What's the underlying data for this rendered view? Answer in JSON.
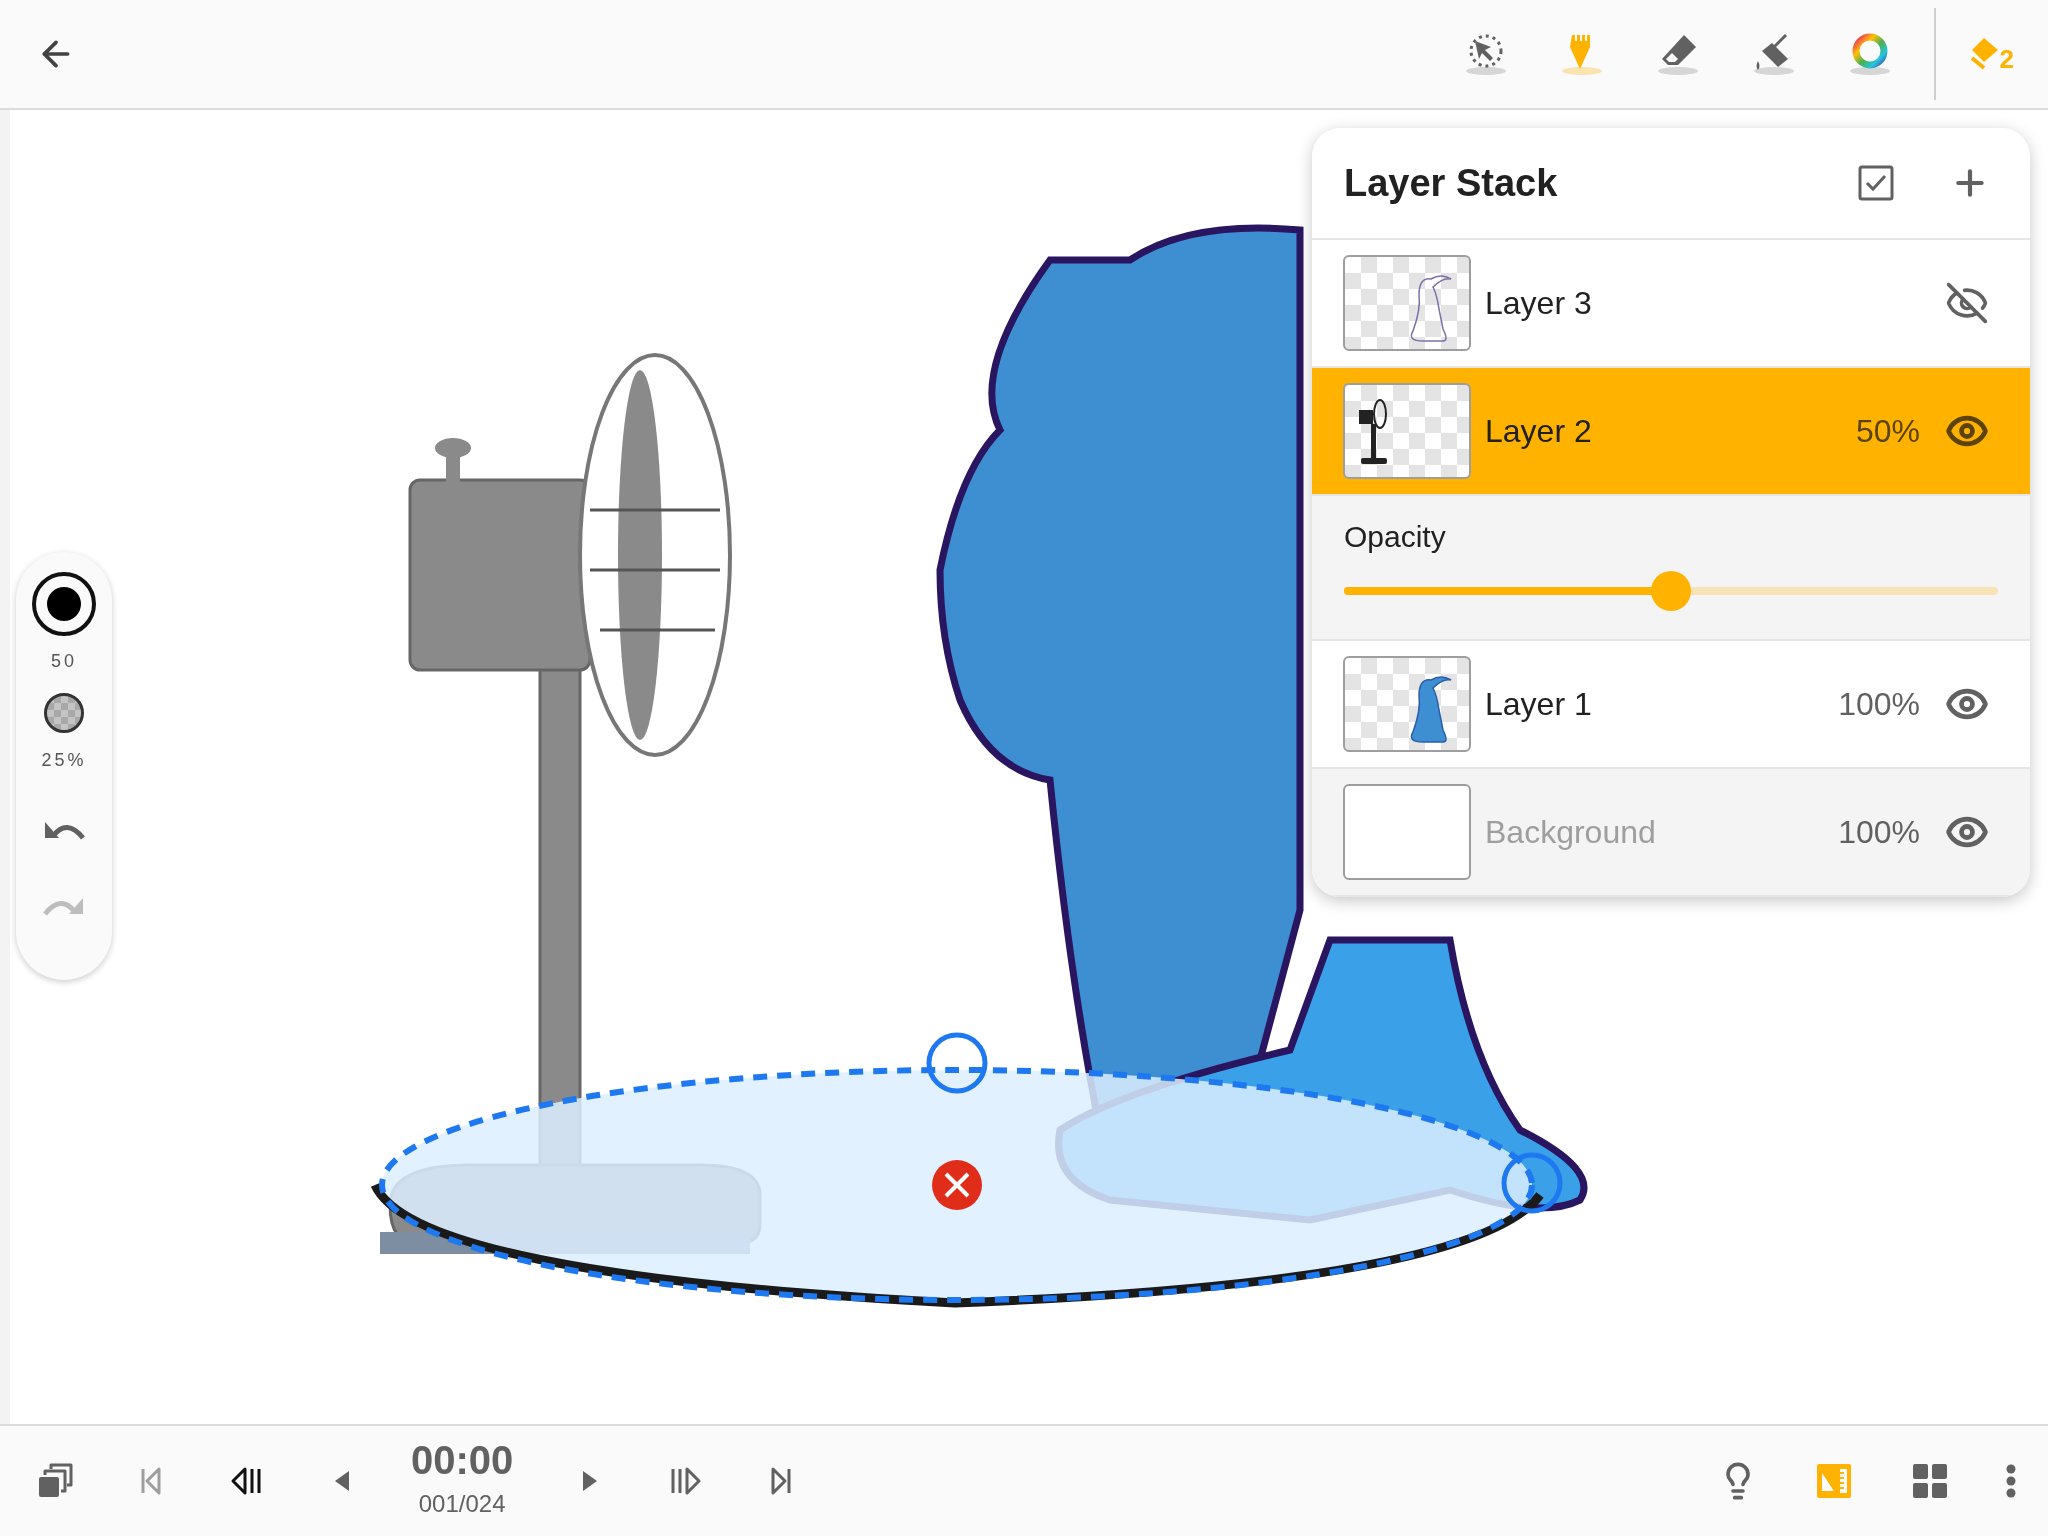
{
  "toolbar": {
    "tools": [
      {
        "kind": "select",
        "selected": false
      },
      {
        "kind": "pencil",
        "selected": true
      },
      {
        "kind": "eraser",
        "selected": false
      },
      {
        "kind": "fill",
        "selected": false
      },
      {
        "kind": "color",
        "selected": false
      }
    ],
    "layers_button": {
      "count": "2"
    }
  },
  "brush_panel": {
    "size": "50",
    "opacity": "25%",
    "undo_disabled": false,
    "redo_disabled": true
  },
  "layer_stack": {
    "title": "Layer Stack",
    "layers": [
      {
        "name": "Layer 3",
        "kind": "outline",
        "visible": false,
        "selected": false
      },
      {
        "name": "Layer 2",
        "kind": "fan",
        "opacity": "50%",
        "visible": true,
        "selected": true
      },
      {
        "name": "Layer 1",
        "kind": "figure",
        "opacity": "100%",
        "visible": true,
        "selected": false
      },
      {
        "name": "Background",
        "kind": "background",
        "opacity": "100%",
        "visible": true,
        "selected": false
      }
    ],
    "opacity_slider": {
      "label": "Opacity",
      "level": 0.5
    }
  },
  "timeline": {
    "controls": [
      {
        "kind": "frames",
        "disabled": false
      },
      {
        "kind": "first",
        "disabled": true
      },
      {
        "kind": "prev_key",
        "disabled": false
      },
      {
        "kind": "prev",
        "disabled": false
      }
    ],
    "time": "00:00",
    "frame": "001/024",
    "controls_after": [
      {
        "kind": "next",
        "disabled": false
      },
      {
        "kind": "next_key",
        "disabled": false
      },
      {
        "kind": "last",
        "disabled": false
      }
    ],
    "tools": [
      {
        "kind": "onion",
        "selected": false
      },
      {
        "kind": "ruler",
        "selected": true
      },
      {
        "kind": "grid",
        "selected": false
      },
      {
        "kind": "more",
        "selected": false
      }
    ]
  }
}
